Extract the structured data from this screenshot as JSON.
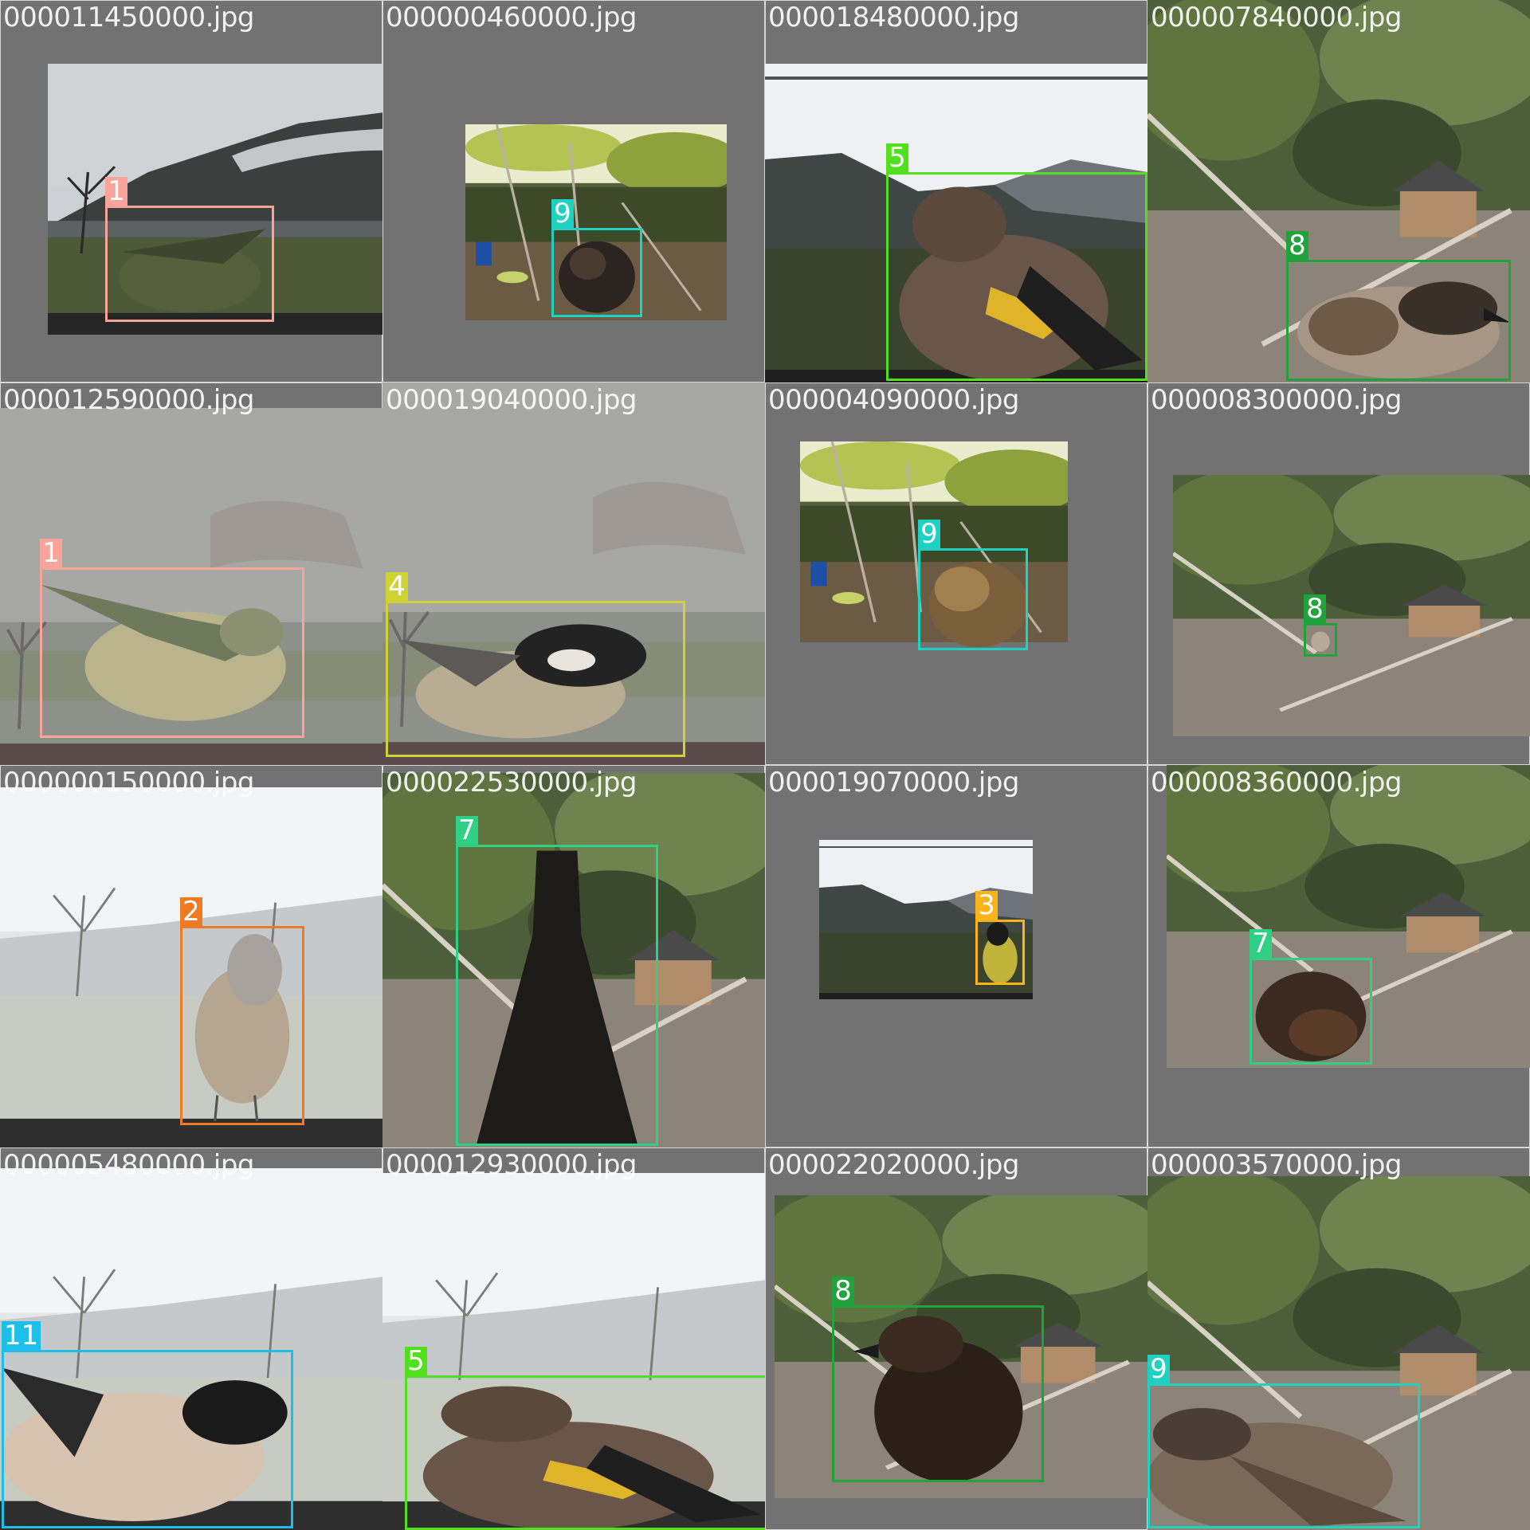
{
  "tiles": [
    {
      "filename": "000011450000.jpg",
      "label": "1",
      "color": "#f8a49a",
      "scene": "foggy-valley",
      "bird": "green-finch-partial"
    },
    {
      "filename": "000000460000.jpg",
      "label": "9",
      "color": "#1fd1c1",
      "scene": "garden",
      "bird": "dark-bird"
    },
    {
      "filename": "000018480000.jpg",
      "label": "5",
      "color": "#52e01e",
      "scene": "valley-dusk",
      "bird": "goldfinch"
    },
    {
      "filename": "000007840000.jpg",
      "label": "8",
      "color": "#1fa33a",
      "scene": "garden-hutch",
      "bird": "sparrow"
    },
    {
      "filename": "000012590000.jpg",
      "label": "1",
      "color": "#f8a49a",
      "scene": "gray-fog",
      "bird": "greenfinch"
    },
    {
      "filename": "000019040000.jpg",
      "label": "4",
      "color": "#cfd233",
      "scene": "gray-fog",
      "bird": "coal-tit"
    },
    {
      "filename": "000004090000.jpg",
      "label": "9",
      "color": "#1fd1c1",
      "scene": "garden",
      "bird": "blurred-sparrow"
    },
    {
      "filename": "000008300000.jpg",
      "label": "8",
      "color": "#1fa33a",
      "scene": "garden-hutch",
      "bird": "tiny-sparrow"
    },
    {
      "filename": "000000150000.jpg",
      "label": "2",
      "color": "#f07a22",
      "scene": "white-fog",
      "bird": "chaffinch"
    },
    {
      "filename": "000022530000.jpg",
      "label": "7",
      "color": "#2fd083",
      "scene": "garden-hutch",
      "bird": "black-tail"
    },
    {
      "filename": "000019070000.jpg",
      "label": "3",
      "color": "#ffb31b",
      "scene": "valley-dusk",
      "bird": "great-tit"
    },
    {
      "filename": "000008360000.jpg",
      "label": "7",
      "color": "#2fd083",
      "scene": "garden-hutch",
      "bird": "robin"
    },
    {
      "filename": "000005480000.jpg",
      "label": "11",
      "color": "#1cbfe8",
      "scene": "white-fog",
      "bird": "bullfinch"
    },
    {
      "filename": "000012930000.jpg",
      "label": "5",
      "color": "#52e01e",
      "scene": "white-fog",
      "bird": "goldfinch"
    },
    {
      "filename": "000022020000.jpg",
      "label": "8",
      "color": "#1fa33a",
      "scene": "garden-hutch",
      "bird": "dark-sparrow"
    },
    {
      "filename": "000003570000.jpg",
      "label": "9",
      "color": "#1fd1c1",
      "scene": "garden-hutch",
      "bird": "sparrow-wing"
    }
  ]
}
